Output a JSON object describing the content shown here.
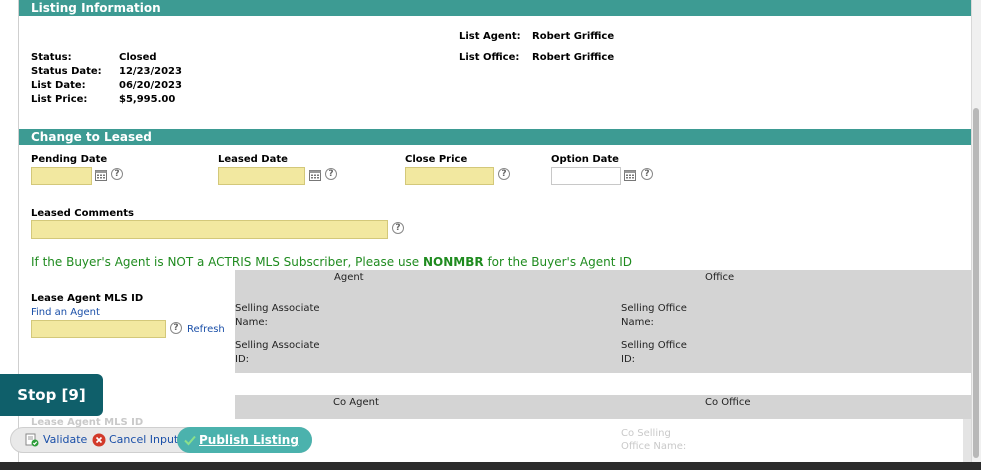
{
  "listing_info": {
    "header": "Listing Information",
    "fields": [
      {
        "label": "Status:",
        "value": "Closed"
      },
      {
        "label": "Status Date:",
        "value": "12/23/2023"
      },
      {
        "label": "List Date:",
        "value": "06/20/2023"
      },
      {
        "label": "List Price:",
        "value": "$5,995.00"
      }
    ],
    "list_agent_label": "List Agent:",
    "list_agent_value": "Robert Griffice",
    "list_office_label": "List Office:",
    "list_office_value": "Robert Griffice"
  },
  "change_to_leased": {
    "header": "Change to Leased",
    "pending_date_label": "Pending Date",
    "leased_date_label": "Leased Date",
    "close_price_label": "Close Price",
    "option_date_label": "Option Date",
    "leased_comments_label": "Leased Comments",
    "note_prefix": "If the Buyer's Agent is NOT a ACTRIS MLS Subscriber, Please use ",
    "note_code": "NONMBR",
    "note_suffix": " for the Buyer's Agent ID"
  },
  "lease_agent": {
    "label": "Lease Agent MLS ID",
    "find_link": "Find an Agent",
    "refresh_link": "Refresh",
    "agent_col": "Agent",
    "office_col": "Office",
    "selling_associate_name": "Selling Associate\nName:",
    "selling_associate_id": "Selling Associate\nID:",
    "selling_office_name": "Selling Office\nName:",
    "selling_office_id": "Selling Office\nID:"
  },
  "co_agent": {
    "agent_col": "Co Agent",
    "office_col": "Co Office",
    "faded_label": "Lease Agent MLS ID",
    "faded_office": "Co Selling\nOffice Name:"
  },
  "stop_button": "Stop [9]",
  "toolbar": {
    "validate": "Validate",
    "cancel": "Cancel Input",
    "publish": "Publish Listing"
  },
  "colors": {
    "header_teal": "#3d9b93",
    "note_green": "#1f8b1f",
    "input_yellow": "#f2e8a0",
    "stop_bg": "#0f5f6a"
  }
}
